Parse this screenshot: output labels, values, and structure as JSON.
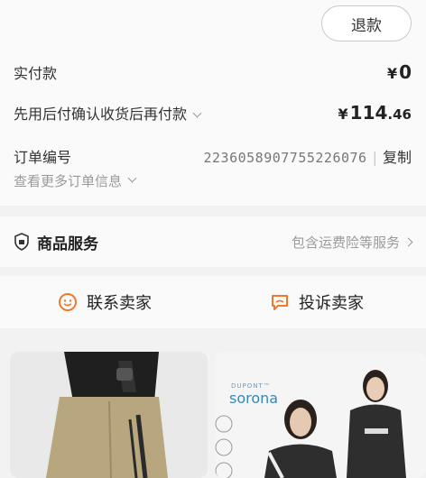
{
  "refund_button": "退款",
  "payment": {
    "paid_label": "实付款",
    "paid_currency": "¥",
    "paid_amount": "0",
    "deferred_label": "先用后付确认收货后再付款",
    "deferred_currency": "¥",
    "deferred_int": "114",
    "deferred_dec": ".46"
  },
  "order": {
    "number_label": "订单编号",
    "number": "2236058907755226076",
    "separator": "|",
    "copy_label": "复制",
    "more_label": "查看更多订单信息"
  },
  "service": {
    "title": "商品服务",
    "summary": "包含运费险等服务"
  },
  "contact": {
    "seller_label": "联系卖家",
    "complaint_label": "投诉卖家"
  },
  "products": {
    "brand_small": "DUPONT™",
    "brand_name": "sorona"
  },
  "colors": {
    "accent_orange": "#f07a2a",
    "text_primary": "#222222",
    "text_secondary": "#9a9a9a"
  }
}
